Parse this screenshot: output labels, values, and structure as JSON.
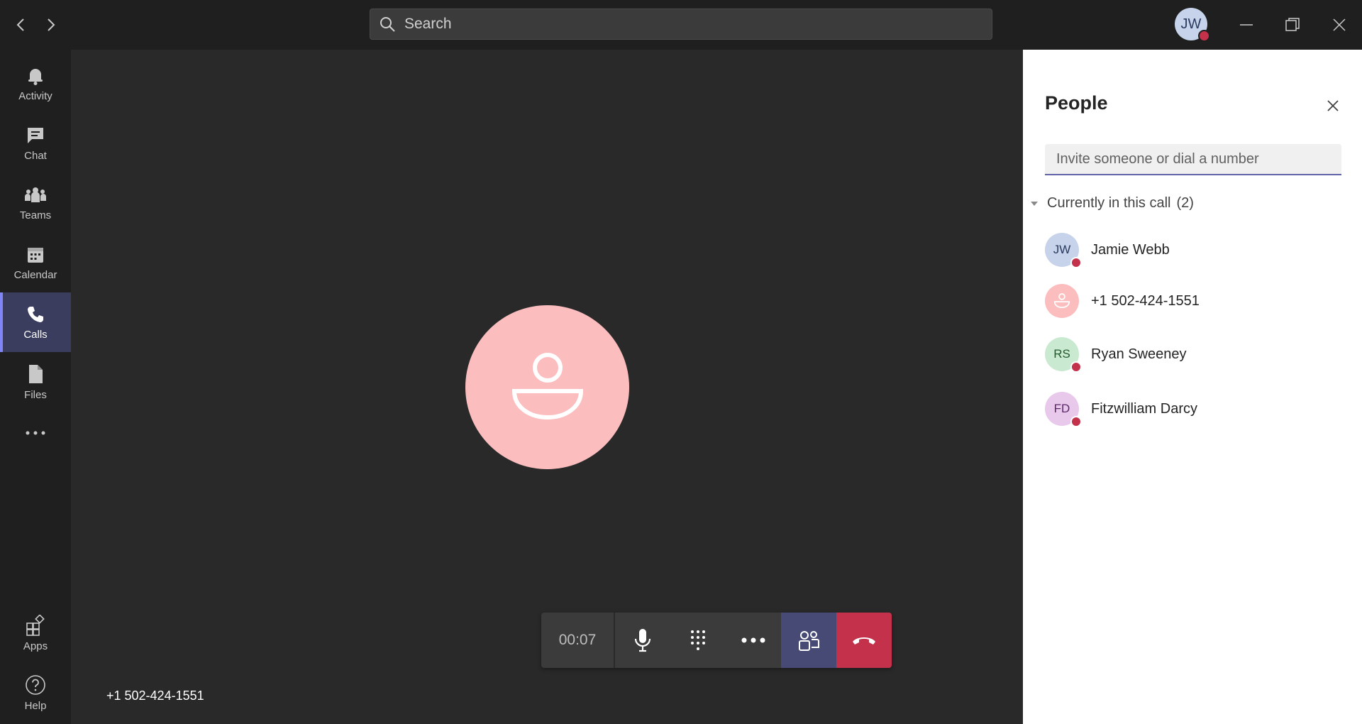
{
  "titlebar": {
    "search_placeholder": "Search",
    "user_initials": "JW",
    "presence_color": "#c4314b"
  },
  "rail": {
    "items": [
      {
        "label": "Activity",
        "icon": "bell-icon"
      },
      {
        "label": "Chat",
        "icon": "chat-icon"
      },
      {
        "label": "Teams",
        "icon": "teams-icon"
      },
      {
        "label": "Calendar",
        "icon": "calendar-icon"
      },
      {
        "label": "Calls",
        "icon": "phone-icon",
        "active": true
      },
      {
        "label": "Files",
        "icon": "file-icon"
      },
      {
        "label": "",
        "icon": "more-icon"
      },
      {
        "label": "Apps",
        "icon": "apps-icon"
      },
      {
        "label": "Help",
        "icon": "help-icon"
      }
    ]
  },
  "call": {
    "caller_number": "+1 502-424-1551",
    "timer": "00:07",
    "avatar_color": "#fcbdbe",
    "hangup_color": "#c4314b"
  },
  "people_panel": {
    "title": "People",
    "invite_placeholder": "Invite someone or dial a number",
    "section_label": "Currently in this call",
    "section_count": "(2)",
    "participants": [
      {
        "initials": "JW",
        "name": "Jamie Webb",
        "avatar_bg": "#c7d3ea",
        "avatar_fg": "#2b3a5f"
      },
      {
        "initials": "",
        "name": "+1 502-424-1551",
        "avatar_bg": "#fcbdbe",
        "avatar_fg": "#ffffff"
      },
      {
        "initials": "RS",
        "name": "Ryan Sweeney",
        "avatar_bg": "#c9ead0",
        "avatar_fg": "#245a2f"
      },
      {
        "initials": "FD",
        "name": "Fitzwilliam Darcy",
        "avatar_bg": "#e8c9ec",
        "avatar_fg": "#5a2a66"
      }
    ]
  }
}
